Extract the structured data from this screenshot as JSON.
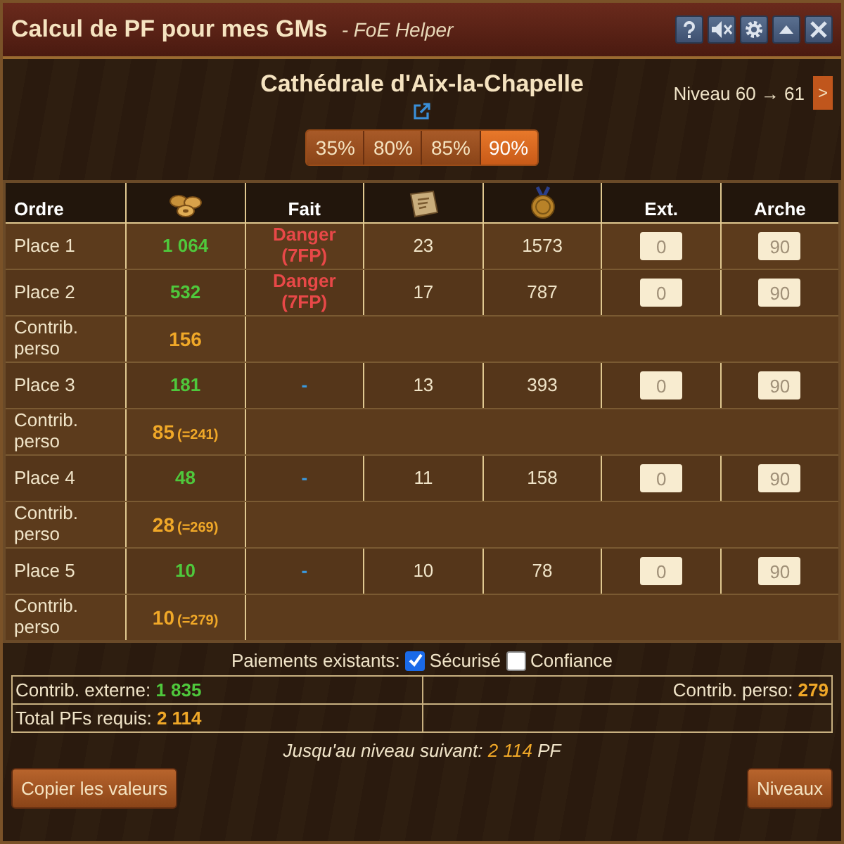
{
  "window": {
    "title": "Calcul de PF pour mes GMs",
    "subtitle": "- FoE Helper"
  },
  "building": {
    "name": "Cathédrale d'Aix-la-Chapelle",
    "level": "Niveau 60 → 61",
    "next_button": ">"
  },
  "percent_buttons": [
    {
      "label": "35%",
      "selected": false
    },
    {
      "label": "80%",
      "selected": false
    },
    {
      "label": "85%",
      "selected": false
    },
    {
      "label": "90%",
      "selected": true
    }
  ],
  "table": {
    "columns": [
      {
        "kind": "text",
        "label": "Ordre"
      },
      {
        "kind": "icon"
      },
      {
        "kind": "text",
        "label": "Fait"
      },
      {
        "kind": "icon"
      },
      {
        "kind": "icon"
      },
      {
        "kind": "text",
        "label": "Ext."
      },
      {
        "kind": "text",
        "label": "Arche"
      }
    ],
    "rows": [
      {
        "kind": "place",
        "label": "Place 1",
        "fp": "1 064",
        "danger": true,
        "done": "Danger",
        "done_detail": "(7FP)",
        "blueprints": "23",
        "medals": "1573",
        "ext": "0",
        "arche": "90"
      },
      {
        "kind": "place",
        "label": "Place 2",
        "fp": "532",
        "danger": true,
        "done": "Danger",
        "done_detail": "(7FP)",
        "blueprints": "17",
        "medals": "787",
        "ext": "0",
        "arche": "90"
      },
      {
        "kind": "own",
        "label": "Contrib. perso",
        "fp": "156"
      },
      {
        "kind": "place",
        "label": "Place 3",
        "fp": "181",
        "danger": false,
        "done": "-",
        "blueprints": "13",
        "medals": "393",
        "ext": "0",
        "arche": "90"
      },
      {
        "kind": "own",
        "label": "Contrib. perso",
        "fp": "85",
        "total": "(=241)"
      },
      {
        "kind": "place",
        "label": "Place 4",
        "fp": "48",
        "danger": false,
        "done": "-",
        "blueprints": "11",
        "medals": "158",
        "ext": "0",
        "arche": "90"
      },
      {
        "kind": "own",
        "label": "Contrib. perso",
        "fp": "28",
        "total": "(=269)"
      },
      {
        "kind": "place",
        "label": "Place 5",
        "fp": "10",
        "danger": false,
        "done": "-",
        "blueprints": "10",
        "medals": "78",
        "ext": "0",
        "arche": "90"
      },
      {
        "kind": "own",
        "label": "Contrib. perso",
        "fp": "10",
        "total": "(=279)"
      }
    ]
  },
  "payments": {
    "label": "Paiements existants:",
    "options": [
      {
        "label": "Sécurisé",
        "checked": true
      },
      {
        "label": "Confiance",
        "checked": false
      }
    ]
  },
  "summary": {
    "external_label": "Contrib. externe:",
    "external_value": "1 835",
    "own_label": "Contrib. perso:",
    "own_value": "279",
    "total_label": "Total PFs requis:",
    "total_value": "2 114"
  },
  "next_level": {
    "label": "Jusqu'au niveau suivant:",
    "value": "2 114",
    "unit": "PF"
  },
  "buttons": {
    "copy": "Copier les valeurs",
    "levels": "Niveaux"
  }
}
